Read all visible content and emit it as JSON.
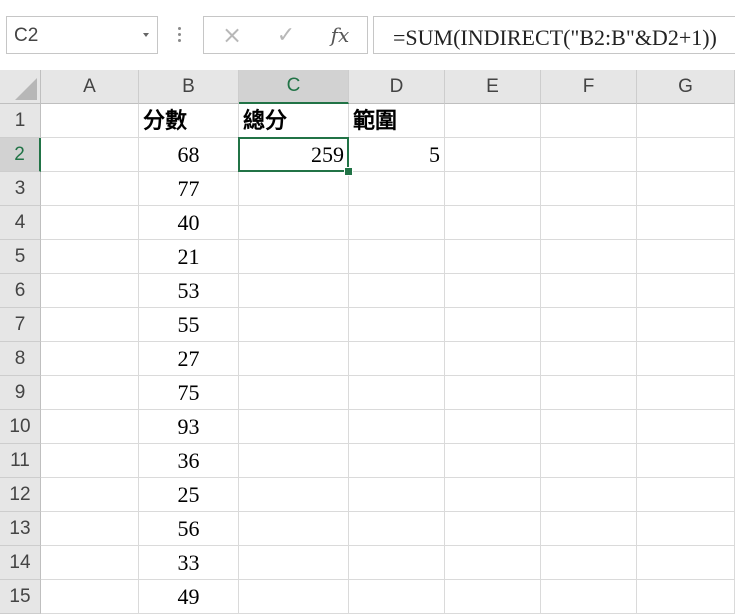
{
  "name_box": {
    "value": "C2"
  },
  "formula_bar": {
    "cancel_icon": "×",
    "enter_icon": "✓",
    "fx_label": "fx",
    "formula": "=SUM(INDIRECT(\"B2:B\"&D2+1))"
  },
  "columns": [
    "A",
    "B",
    "C",
    "D",
    "E",
    "F",
    "G"
  ],
  "rows": [
    "1",
    "2",
    "3",
    "4",
    "5",
    "6",
    "7",
    "8",
    "9",
    "10",
    "11",
    "12",
    "13",
    "14",
    "15"
  ],
  "active_cell": {
    "col": "C",
    "row": "2"
  },
  "cells": {
    "B1": "分數",
    "C1": "總分",
    "D1": "範圍",
    "B2": "68",
    "C2": "259",
    "D2": "5",
    "B3": "77",
    "B4": "40",
    "B5": "21",
    "B6": "53",
    "B7": "55",
    "B8": "27",
    "B9": "75",
    "B10": "93",
    "B11": "36",
    "B12": "25",
    "B13": "56",
    "B14": "33",
    "B15": "49"
  }
}
